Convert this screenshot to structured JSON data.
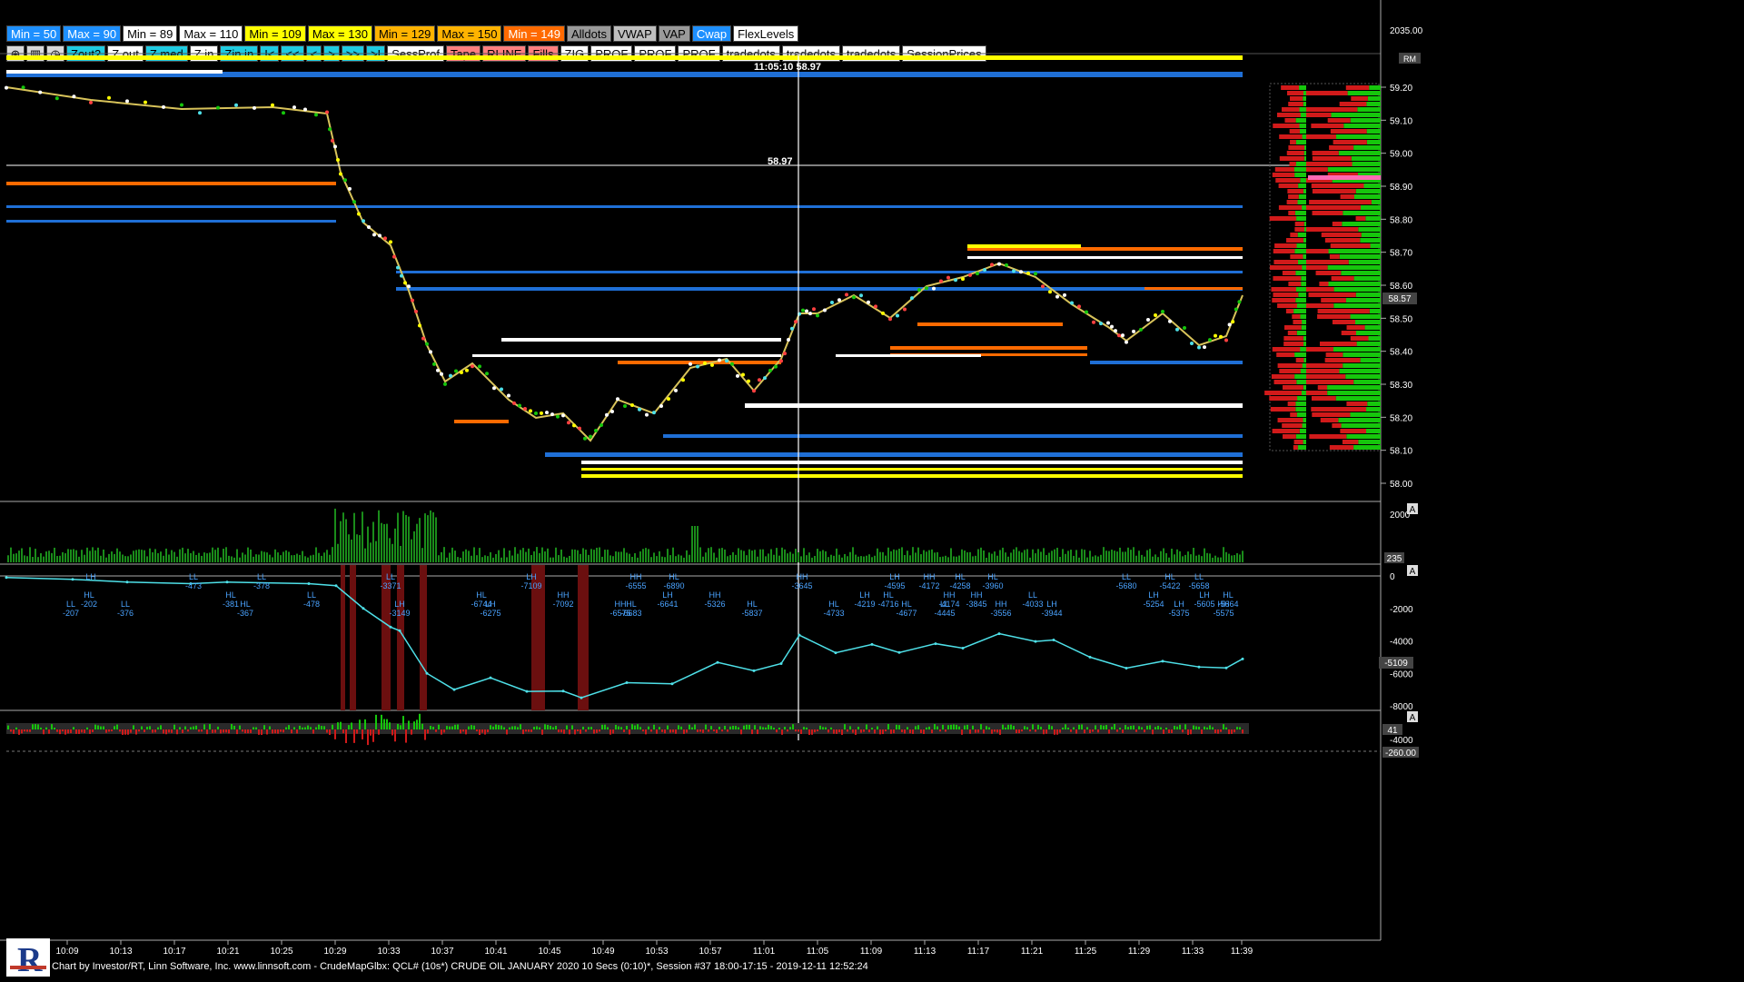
{
  "toolbar_row1": [
    {
      "label": "Min = 50",
      "bg": "#1e90ff",
      "fg": "#fff"
    },
    {
      "label": "Max = 90",
      "bg": "#1e90ff",
      "fg": "#fff"
    },
    {
      "label": "Min = 89",
      "bg": "#ffffff",
      "fg": "#000"
    },
    {
      "label": "Max = 110",
      "bg": "#ffffff",
      "fg": "#000"
    },
    {
      "label": "Min = 109",
      "bg": "#ffff00",
      "fg": "#000"
    },
    {
      "label": "Max = 130",
      "bg": "#ffff00",
      "fg": "#000"
    },
    {
      "label": "Min = 129",
      "bg": "#ffb300",
      "fg": "#000"
    },
    {
      "label": "Max = 150",
      "bg": "#ffb300",
      "fg": "#000"
    },
    {
      "label": "Min = 149",
      "bg": "#ff6a00",
      "fg": "#fff"
    },
    {
      "label": "Alldots",
      "bg": "#9a9a9a",
      "fg": "#000"
    },
    {
      "label": "VWAP",
      "bg": "#bfbfbf",
      "fg": "#000"
    },
    {
      "label": "VAP",
      "bg": "#9a9a9a",
      "fg": "#000"
    },
    {
      "label": "Cwap",
      "bg": "#1e90ff",
      "fg": "#fff"
    },
    {
      "label": "FlexLevels",
      "bg": "#ffffff",
      "fg": "#000"
    }
  ],
  "toolbar_row2": [
    {
      "label": "Zout2",
      "bg": "#1ecbe1",
      "fg": "#000"
    },
    {
      "label": "Z out",
      "bg": "#ffffff",
      "fg": "#000"
    },
    {
      "label": "Z med",
      "bg": "#1ecbe1",
      "fg": "#000"
    },
    {
      "label": "Z in",
      "bg": "#ffffff",
      "fg": "#000"
    },
    {
      "label": "Zin in",
      "bg": "#1ecbe1",
      "fg": "#000"
    },
    {
      "label": "I<",
      "bg": "#1ecbe1",
      "fg": "#000"
    },
    {
      "label": "<<",
      "bg": "#1ecbe1",
      "fg": "#000"
    },
    {
      "label": "<",
      "bg": "#1ecbe1",
      "fg": "#000"
    },
    {
      "label": ">",
      "bg": "#1ecbe1",
      "fg": "#000"
    },
    {
      "label": ">>",
      "bg": "#1ecbe1",
      "fg": "#000"
    },
    {
      "label": ">I",
      "bg": "#1ecbe1",
      "fg": "#000"
    },
    {
      "label": "SessProf",
      "bg": "#ffffff",
      "fg": "#000"
    },
    {
      "label": "Tape",
      "bg": "#ff7f7f",
      "fg": "#000"
    },
    {
      "label": "RLINE",
      "bg": "#ff7f7f",
      "fg": "#000"
    },
    {
      "label": "Fills",
      "bg": "#ff7f7f",
      "fg": "#000"
    },
    {
      "label": "ZIG",
      "bg": "#ffffff",
      "fg": "#000"
    },
    {
      "label": "PROF",
      "bg": "#ffffff",
      "fg": "#000"
    },
    {
      "label": "PROF",
      "bg": "#ffffff",
      "fg": "#000"
    },
    {
      "label": "PROF",
      "bg": "#ffffff",
      "fg": "#000"
    },
    {
      "label": "tradedots",
      "bg": "#ffffff",
      "fg": "#000"
    },
    {
      "label": "tradedots",
      "bg": "#ffffff",
      "fg": "#000"
    },
    {
      "label": "tradedots",
      "bg": "#ffffff",
      "fg": "#000"
    },
    {
      "label": "SessionPrices",
      "bg": "#ffffff",
      "fg": "#000"
    }
  ],
  "icons": [
    "zoom-icon",
    "bars-icon",
    "clock-icon"
  ],
  "crosshair": {
    "time_price": "11:05:10 58.97",
    "price": "58.97"
  },
  "price_axis": {
    "ticks": [
      "59.20",
      "59.10",
      "59.00",
      "58.90",
      "58.80",
      "58.70",
      "58.60",
      "58.50",
      "58.40",
      "58.30",
      "58.20",
      "58.10",
      "58.00"
    ],
    "top_label": "2035.00",
    "rm": "RM",
    "current": "58.57"
  },
  "volume_axis": {
    "ticks": [
      "2000"
    ],
    "current": "235",
    "a": "A"
  },
  "cvd_axis": {
    "ticks": [
      "0",
      "-2000",
      "-4000",
      "-6000",
      "-8000"
    ],
    "current": "-5109",
    "a": "A"
  },
  "delta_axis": {
    "ticks": [
      "-4000"
    ],
    "current": "41",
    "extra": "-260.00",
    "a": "A"
  },
  "time_axis": [
    "10:09",
    "10:13",
    "10:17",
    "10:21",
    "10:25",
    "10:29",
    "10:33",
    "10:37",
    "10:41",
    "10:45",
    "10:49",
    "10:53",
    "10:57",
    "11:01",
    "11:05",
    "11:09",
    "11:13",
    "11:17",
    "11:21",
    "11:25",
    "11:29",
    "11:33",
    "11:39"
  ],
  "swing_labels": [
    {
      "t": "LL",
      "v": "-207",
      "c": "#4aa3ff"
    },
    {
      "t": "LH",
      "v": "",
      "c": "#4aa3ff"
    },
    {
      "t": "HL",
      "v": "-202",
      "c": "#4aa3ff"
    },
    {
      "t": "LL",
      "v": "-376",
      "c": "#4aa3ff"
    },
    {
      "t": "LL",
      "v": "-473",
      "c": "#4aa3ff"
    },
    {
      "t": "HL",
      "v": "-381",
      "c": "#4aa3ff"
    },
    {
      "t": "HL",
      "v": "-367",
      "c": "#4aa3ff"
    },
    {
      "t": "LL",
      "v": "-378",
      "c": "#4aa3ff"
    },
    {
      "t": "LL",
      "v": "-478",
      "c": "#4aa3ff"
    },
    {
      "t": "LH",
      "v": "-3149",
      "c": "#4aa3ff"
    },
    {
      "t": "LL",
      "v": "-3371",
      "c": "#4aa3ff"
    },
    {
      "t": "HL",
      "v": "-6744",
      "c": "#4aa3ff"
    },
    {
      "t": "LH",
      "v": "-6275",
      "c": "#4aa3ff"
    },
    {
      "t": "LH",
      "v": "-7109",
      "c": "#4aa3ff"
    },
    {
      "t": "HH",
      "v": "-7092",
      "c": "#4aa3ff"
    },
    {
      "t": "HH",
      "v": "-6575",
      "c": "#4aa3ff"
    },
    {
      "t": "HH",
      "v": "-6555",
      "c": "#4aa3ff"
    },
    {
      "t": "LH",
      "v": "-6641",
      "c": "#4aa3ff"
    },
    {
      "t": "HL",
      "v": "-6683",
      "c": "#4aa3ff"
    },
    {
      "t": "HL",
      "v": "-6890",
      "c": "#4aa3ff"
    },
    {
      "t": "HH",
      "v": "-5326",
      "c": "#4aa3ff"
    },
    {
      "t": "HL",
      "v": "-5837",
      "c": "#4aa3ff"
    },
    {
      "t": "HH",
      "v": "-3645",
      "c": "#4aa3ff"
    },
    {
      "t": "LH",
      "v": "-4219",
      "c": "#4aa3ff"
    },
    {
      "t": "HL",
      "v": "-4733",
      "c": "#4aa3ff"
    },
    {
      "t": "LH",
      "v": "-4595",
      "c": "#4aa3ff"
    },
    {
      "t": "HL",
      "v": "-4716",
      "c": "#4aa3ff"
    },
    {
      "t": "HL",
      "v": "-4677",
      "c": "#4aa3ff"
    },
    {
      "t": "HH",
      "v": "-4172",
      "c": "#4aa3ff"
    },
    {
      "t": "HH",
      "v": "-4174",
      "c": "#4aa3ff"
    },
    {
      "t": "LL",
      "v": "-4445",
      "c": "#4aa3ff"
    },
    {
      "t": "HL",
      "v": "-4258",
      "c": "#4aa3ff"
    },
    {
      "t": "HH",
      "v": "-3845",
      "c": "#4aa3ff"
    },
    {
      "t": "HH",
      "v": "-3556",
      "c": "#4aa3ff"
    },
    {
      "t": "HL",
      "v": "-3960",
      "c": "#4aa3ff"
    },
    {
      "t": "LL",
      "v": "-4033",
      "c": "#4aa3ff"
    },
    {
      "t": "LH",
      "v": "-3944",
      "c": "#4aa3ff"
    },
    {
      "t": "LL",
      "v": "-5680",
      "c": "#4aa3ff"
    },
    {
      "t": "LH",
      "v": "-5254",
      "c": "#4aa3ff"
    },
    {
      "t": "LH",
      "v": "-5375",
      "c": "#4aa3ff"
    },
    {
      "t": "HL",
      "v": "-5422",
      "c": "#4aa3ff"
    },
    {
      "t": "LH",
      "v": "-5605",
      "c": "#4aa3ff"
    },
    {
      "t": "HH",
      "v": "-5575",
      "c": "#4aa3ff"
    },
    {
      "t": "LL",
      "v": "-5658",
      "c": "#4aa3ff"
    },
    {
      "t": "HL",
      "v": "-5664",
      "c": "#4aa3ff"
    }
  ],
  "status_text": "Chart by Investor/RT, Linn Software, Inc. www.linnsoft.com - CrudeMapGlbx: QCL# (10s*) CRUDE OIL JANUARY 2020 10 Secs (0:10)*, Session #37 18:00-17:15 - 2019-12-11 12:52:24",
  "colors": {
    "blue": "#1f6fd6",
    "white": "#ffffff",
    "yellow": "#ffff00",
    "orange": "#ff6a00",
    "cyan": "#4ee0e8",
    "green": "#16c60c",
    "red": "#d11a1a"
  }
}
